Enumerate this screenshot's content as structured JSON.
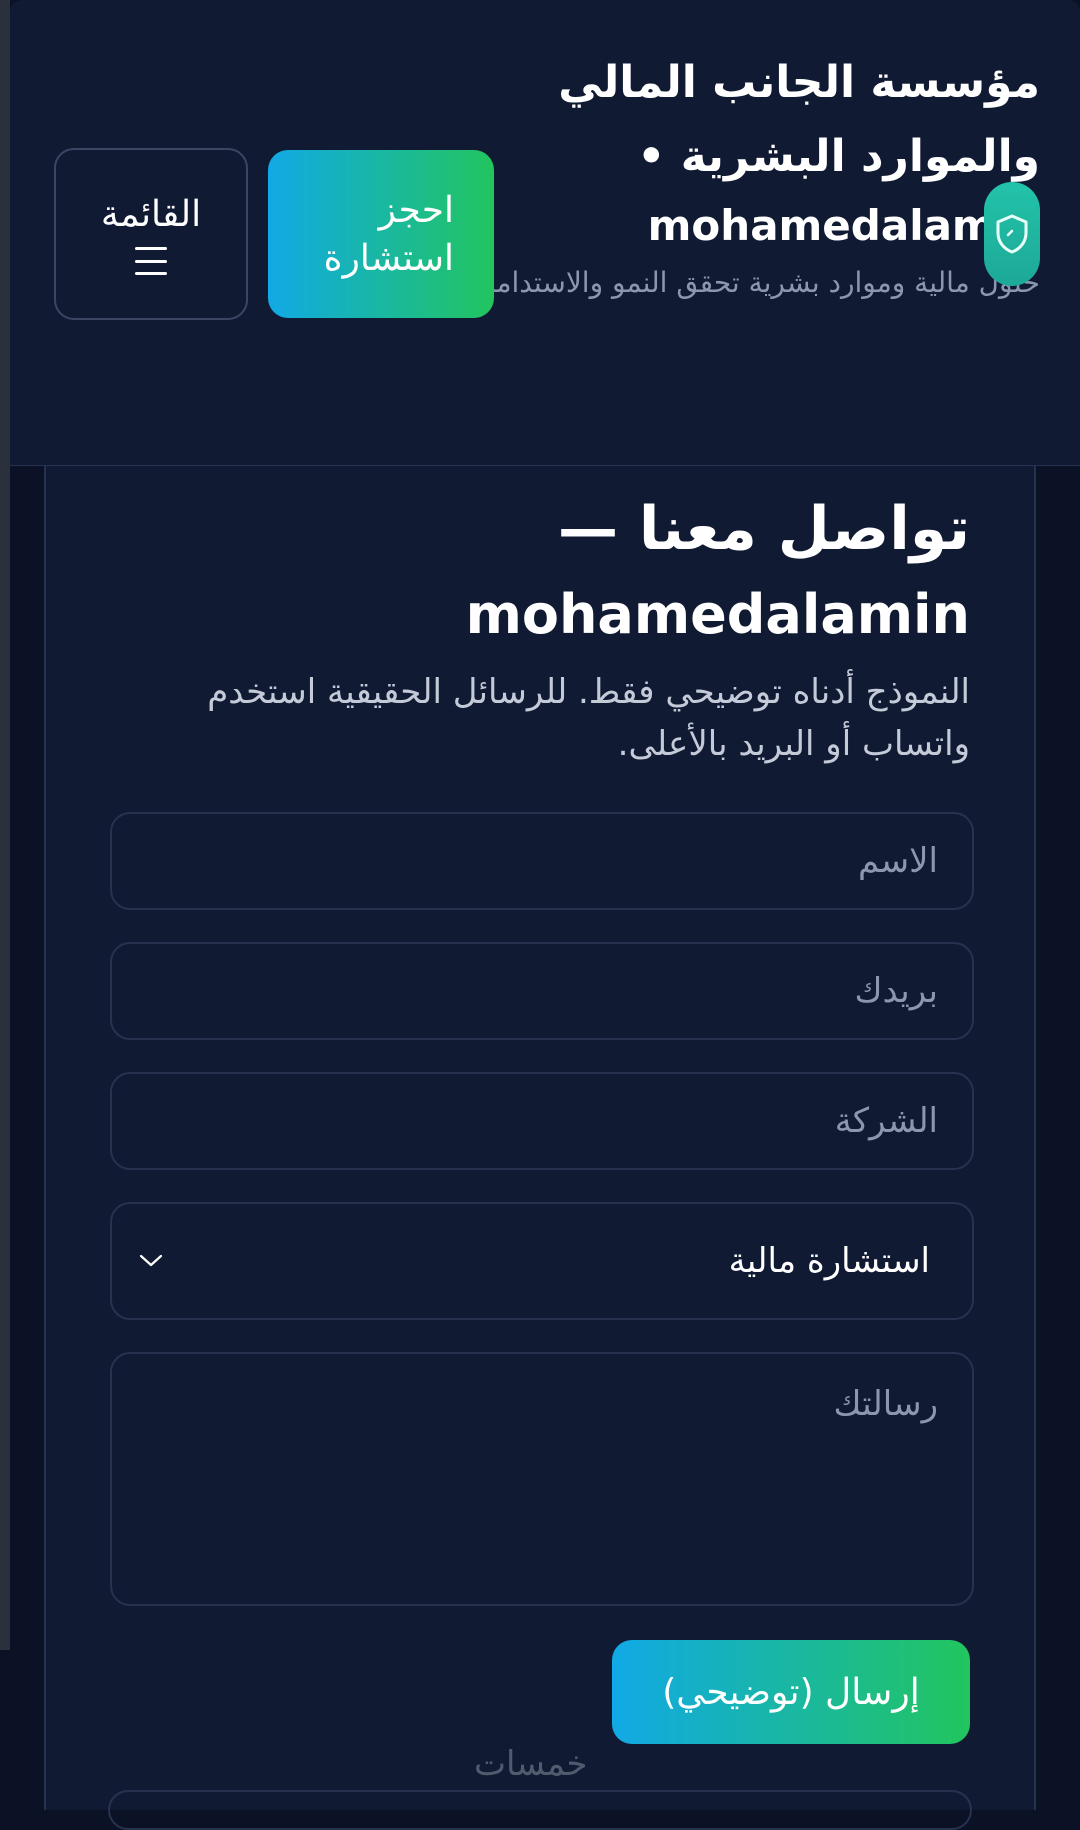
{
  "header": {
    "brand_title": "مؤسسة الجانب المالي والموارد البشرية •",
    "brand_latin": "mohamedalamin",
    "brand_tagline": "حلول مالية وموارد بشرية تحقق النمو والاستدامة",
    "logo_icon": "shield-icon",
    "book_button_label": "احجز استشارة",
    "menu_button_label": "القائمة",
    "menu_icon": "hamburger-icon"
  },
  "contact": {
    "title": "تواصل معنا —",
    "title_latin": "mohamedalamin",
    "description": "النموذج أدناه توضيحي فقط. للرسائل الحقيقية استخدم واتساب أو البريد بالأعلى.",
    "name_placeholder": "الاسم",
    "email_placeholder": "بريدك",
    "company_placeholder": "الشركة",
    "service_selected": "استشارة مالية",
    "message_placeholder": "رسالتك",
    "send_label": "إرسال (توضيحي)"
  },
  "watermark": "خمسات",
  "colors": {
    "background": "#0b1226",
    "panel": "#111a33",
    "accent_start": "#11a9e6",
    "accent_end": "#22c55e",
    "muted_text": "#8c96ad"
  }
}
